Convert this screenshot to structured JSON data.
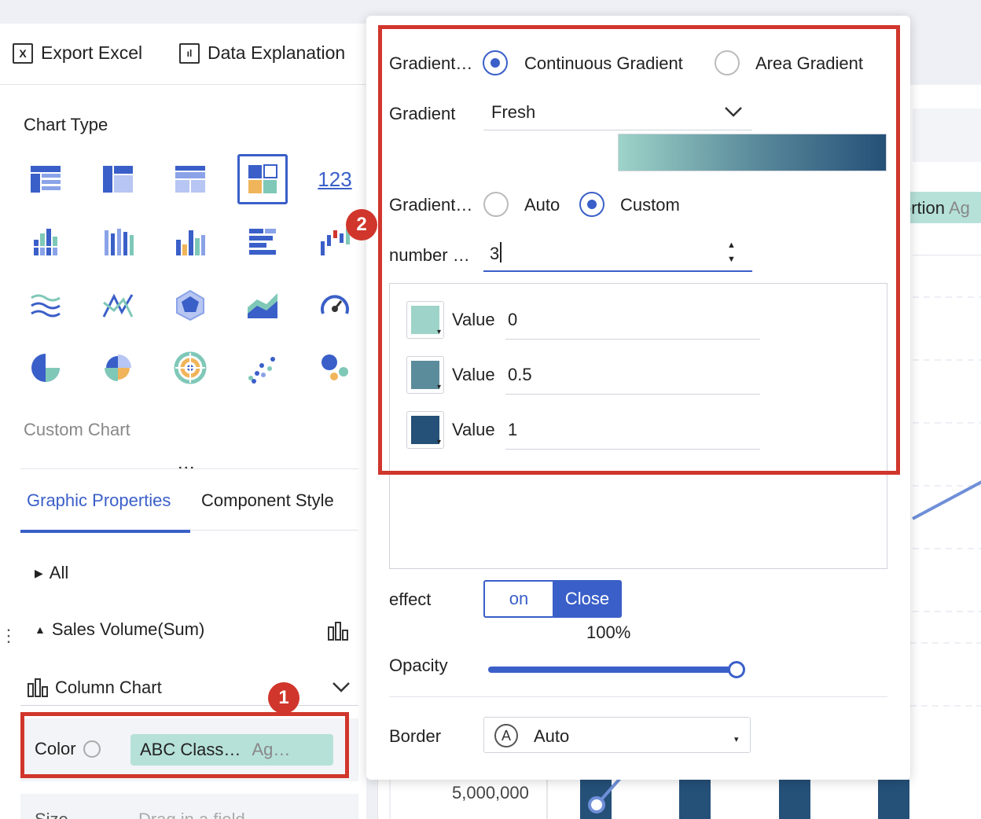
{
  "toolbar": {
    "export_label": "Export Excel",
    "explain_label": "Data Explanation"
  },
  "left": {
    "chart_type_title": "Chart Type",
    "number_icon_text": "123",
    "custom_chart_label": "Custom Chart",
    "more_dots": "⋮",
    "tabs": [
      "Graphic Properties",
      "Component Style"
    ],
    "all_label": "All",
    "field_label": "Sales Volume(Sum)",
    "chart_select_label": "Column Chart",
    "color_label": "Color",
    "color_field_name": "ABC Class…",
    "color_field_agg": "Ag…",
    "size_label": "Size",
    "size_placeholder": "Drag in a field"
  },
  "background": {
    "tag_text": "ortion",
    "tag_suffix": "Ag",
    "axis_value": "5,000,000"
  },
  "popup": {
    "gradient_type_label": "Gradient…",
    "gradient_type_options": [
      "Continuous Gradient",
      "Area Gradient"
    ],
    "gradient_type_selected": "Continuous Gradient",
    "gradient_label": "Gradient",
    "gradient_value": "Fresh",
    "gradient_colors": [
      "#9dd3c8",
      "#5b8c9c",
      "#255078"
    ],
    "gradient_mode_label": "Gradient…",
    "gradient_mode_options": [
      "Auto",
      "Custom"
    ],
    "gradient_mode_selected": "Custom",
    "number_label": "number …",
    "number_value": "3",
    "stops": [
      {
        "label": "Value",
        "value": "0",
        "color": "#9dd3c8"
      },
      {
        "label": "Value",
        "value": "0.5",
        "color": "#5b8c9c"
      },
      {
        "label": "Value",
        "value": "1",
        "color": "#255078"
      }
    ],
    "effect_label": "effect",
    "effect_options": [
      "on",
      "Close"
    ],
    "effect_selected": "Close",
    "opacity_value_text": "100%",
    "opacity_label": "Opacity",
    "opacity_fraction": 1.0,
    "border_label": "Border",
    "border_icon_text": "A",
    "border_value": "Auto"
  },
  "annotations": {
    "badge_1": "1",
    "badge_2": "2"
  },
  "colors": {
    "accent": "#3a5fc8",
    "highlight": "#d0362c",
    "tag_bg": "#b6e1d9",
    "bar": "#255078"
  }
}
